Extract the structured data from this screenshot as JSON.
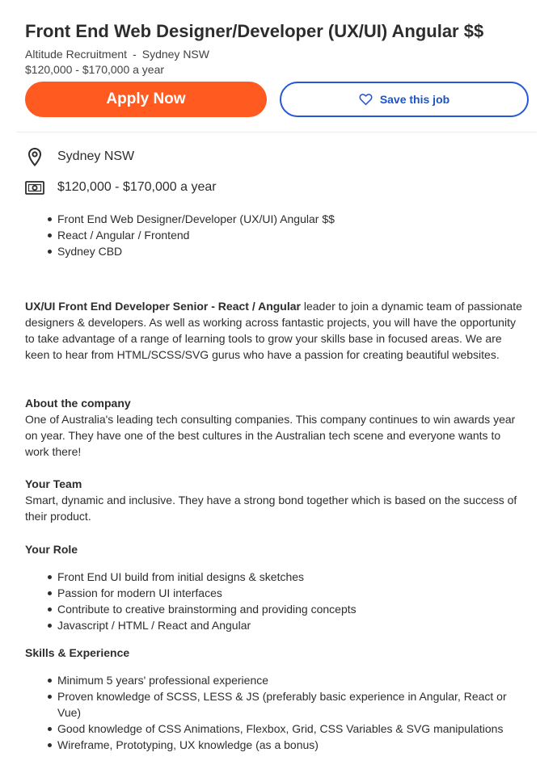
{
  "job": {
    "title": "Front End Web Designer/Developer (UX/UI) Angular $$",
    "company": "Altitude Recruitment",
    "separator": "-",
    "location": "Sydney NSW",
    "salary": "$120,000 - $170,000 a year"
  },
  "actions": {
    "apply_label": "Apply Now",
    "save_label": "Save this job",
    "apply_color": "#ff5a1f",
    "save_color": "#2557d6"
  },
  "details": {
    "location": "Sydney NSW",
    "salary": "$120,000 - $170,000 a year",
    "location_icon": "location-pin-icon",
    "salary_icon": "banknote-icon"
  },
  "highlights": [
    "Front End Web Designer/Developer (UX/UI) Angular $$",
    "React / Angular / Frontend",
    "Sydney CBD"
  ],
  "description": {
    "intro_bold": "UX/UI Front End Developer Senior - React / Angular",
    "intro_rest": " leader to join a dynamic team of passionate designers & developers. As well as working across fantastic projects, you will have the opportunity to take advantage of a range of learning tools to grow your skills base in focused areas. We are keen to hear from HTML/SCSS/SVG gurus who have a passion for creating beautiful websites.",
    "about_heading": "About the company",
    "about_text": "One of Australia's leading tech consulting companies. This company continues to win awards year on year. They have one of the best cultures in the Australian tech scene and everyone wants to work there!",
    "team_heading": "Your Team",
    "team_text": "Smart, dynamic and inclusive. They have a strong bond together which is based on the success of their product.",
    "role_heading": "Your Role",
    "role_items": [
      "Front End UI build from initial designs & sketches",
      "Passion for modern UI interfaces",
      "Contribute to creative brainstorming and providing concepts",
      "Javascript / HTML / React and Angular"
    ],
    "skills_heading": "Skills & Experience",
    "skills_items": [
      "Minimum 5 years' professional experience",
      "Proven knowledge of SCSS, LESS & JS (preferably basic experience in Angular, React or Vue)",
      "Good knowledge of CSS Animations, Flexbox, Grid, CSS Variables & SVG manipulations",
      "Wireframe, Prototyping, UX knowledge (as a bonus)"
    ]
  }
}
